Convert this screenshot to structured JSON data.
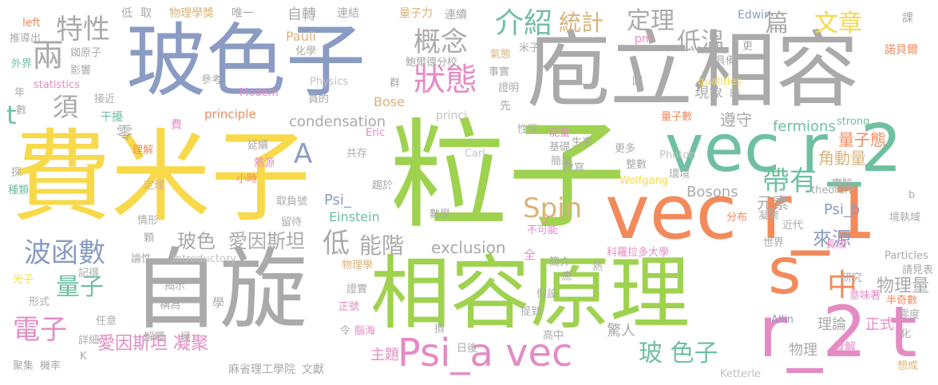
{
  "palette": {
    "yellow": "#f7d94a",
    "green": "#9ed24f",
    "gray": "#aaaaaa",
    "slate": "#8a9cc4",
    "orange": "#f28a5b",
    "pink": "#e48bc4",
    "teal": "#6fc0a0",
    "tan": "#d9b37a",
    "lightgray": "#c2c2c2",
    "darkgray": "#9a9a9a"
  },
  "words": [
    {
      "t": "費米子",
      "c": "yellow"
    },
    {
      "t": "粒子",
      "c": "green"
    },
    {
      "t": "自旋",
      "c": "gray"
    },
    {
      "t": "玻色子",
      "c": "slate"
    },
    {
      "t": "相容原理",
      "c": "green"
    },
    {
      "t": "庖立相容",
      "c": "gray"
    },
    {
      "t": "vec r_1",
      "c": "orange"
    },
    {
      "t": "vec r_2",
      "c": "teal"
    },
    {
      "t": "r_2 t",
      "c": "pink"
    },
    {
      "t": "s",
      "c": "orange"
    },
    {
      "t": "Psi_a vec",
      "c": "pink"
    },
    {
      "t": "兩",
      "c": "gray"
    },
    {
      "t": "特性",
      "c": "gray"
    },
    {
      "t": "概念",
      "c": "gray"
    },
    {
      "t": "狀態",
      "c": "pink"
    },
    {
      "t": "介紹",
      "c": "teal"
    },
    {
      "t": "統計",
      "c": "tan"
    },
    {
      "t": "定理",
      "c": "gray"
    },
    {
      "t": "低溫",
      "c": "gray"
    },
    {
      "t": "篇",
      "c": "gray"
    },
    {
      "t": "文章",
      "c": "yellow"
    },
    {
      "t": "波函數",
      "c": "slate"
    },
    {
      "t": "量子",
      "c": "teal"
    },
    {
      "t": "電子",
      "c": "pink"
    },
    {
      "t": "玻色",
      "c": "gray"
    },
    {
      "t": "愛因斯坦",
      "c": "gray"
    },
    {
      "t": "低",
      "c": "gray"
    },
    {
      "t": "能階",
      "c": "gray"
    },
    {
      "t": "Spin",
      "c": "tan"
    },
    {
      "t": "帶有",
      "c": "teal"
    },
    {
      "t": "中",
      "c": "orange"
    },
    {
      "t": "玻 色子",
      "c": "teal"
    },
    {
      "t": "愛因斯坦 凝聚",
      "c": "pink"
    },
    {
      "t": "A",
      "c": "slate"
    },
    {
      "t": "須",
      "c": "gray"
    },
    {
      "t": "t",
      "c": "teal"
    },
    {
      "t": "condensation",
      "c": "gray"
    },
    {
      "t": "Bose",
      "c": "tan"
    },
    {
      "t": "exclusion",
      "c": "gray"
    },
    {
      "t": "Bosons",
      "c": "gray"
    },
    {
      "t": "Psi_",
      "c": "slate"
    },
    {
      "t": "Einstein",
      "c": "teal"
    },
    {
      "t": "元素",
      "c": "gray"
    },
    {
      "t": "角動量",
      "c": "tan"
    },
    {
      "t": "量子態",
      "c": "orange"
    },
    {
      "t": "fermions",
      "c": "teal"
    },
    {
      "t": "來源",
      "c": "slate"
    },
    {
      "t": "物理量",
      "c": "gray"
    },
    {
      "t": "Psi_b",
      "c": "slate"
    },
    {
      "t": "遵守",
      "c": "gray"
    },
    {
      "t": "現象",
      "c": "gray"
    },
    {
      "t": "驚人",
      "c": "gray"
    },
    {
      "t": "理論",
      "c": "gray"
    },
    {
      "t": "正式",
      "c": "pink"
    },
    {
      "t": "物理",
      "c": "gray"
    },
    {
      "t": "費解",
      "c": "pink"
    },
    {
      "t": "主題",
      "c": "pink"
    },
    {
      "t": "麻省理工學院",
      "c": "gray"
    },
    {
      "t": "文獻",
      "c": "gray"
    },
    {
      "t": "Ketterle",
      "c": "lightgray"
    },
    {
      "t": "Pauli",
      "c": "tan"
    },
    {
      "t": "pm",
      "c": "pink"
    },
    {
      "t": "自轉",
      "c": "gray"
    },
    {
      "t": "量子力",
      "c": "tan"
    },
    {
      "t": "連續",
      "c": "gray"
    },
    {
      "t": "物理學獎",
      "c": "tan"
    },
    {
      "t": "唯一",
      "c": "gray"
    },
    {
      "t": "連結",
      "c": "gray"
    },
    {
      "t": "Edwin",
      "c": "slate"
    },
    {
      "t": "課",
      "c": "gray"
    },
    {
      "t": "諾貝爾",
      "c": "orange"
    },
    {
      "t": "取",
      "c": "gray"
    },
    {
      "t": "低",
      "c": "gray"
    },
    {
      "t": "left",
      "c": "orange"
    },
    {
      "t": "推導出",
      "c": "gray"
    },
    {
      "t": "銣原子",
      "c": "gray"
    },
    {
      "t": "外界",
      "c": "teal"
    },
    {
      "t": "影響",
      "c": "gray"
    },
    {
      "t": "化學",
      "c": "gray"
    },
    {
      "t": "鮑爾德分校",
      "c": "gray"
    },
    {
      "t": "氣態",
      "c": "tan"
    },
    {
      "t": "米子",
      "c": "gray"
    },
    {
      "t": "事實",
      "c": "gray"
    },
    {
      "t": "具備",
      "c": "gray"
    },
    {
      "t": "更",
      "c": "gray"
    },
    {
      "t": "statistics",
      "c": "pink"
    },
    {
      "t": "Physics",
      "c": "lightgray"
    },
    {
      "t": "qualities",
      "c": "yellow"
    },
    {
      "t": "Modern",
      "c": "pink"
    },
    {
      "t": "參考",
      "c": "gray"
    },
    {
      "t": "年",
      "c": "gray"
    },
    {
      "t": "接近",
      "c": "gray"
    },
    {
      "t": "數",
      "c": "gray"
    },
    {
      "t": "員的",
      "c": "gray"
    },
    {
      "t": "群",
      "c": "gray"
    },
    {
      "t": "證明",
      "c": "gray"
    },
    {
      "t": "圖",
      "c": "gray"
    },
    {
      "t": "時",
      "c": "gray"
    },
    {
      "t": "實驗",
      "c": "gray"
    },
    {
      "t": "principle",
      "c": "orange"
    },
    {
      "t": "先",
      "c": "gray"
    },
    {
      "t": "princi",
      "c": "lightgray"
    },
    {
      "t": "干擾",
      "c": "teal"
    },
    {
      "t": "零",
      "c": "gray"
    },
    {
      "t": "費",
      "c": "pink"
    },
    {
      "t": "性質",
      "c": "gray"
    },
    {
      "t": "量子數",
      "c": "orange"
    },
    {
      "t": "strong",
      "c": "teal"
    },
    {
      "t": "理解",
      "c": "orange"
    },
    {
      "t": "Eric",
      "c": "pink"
    },
    {
      "t": "能量",
      "c": "pink"
    },
    {
      "t": "生來",
      "c": "gray"
    },
    {
      "t": "Photon",
      "c": "lightgray"
    },
    {
      "t": "延續",
      "c": "gray"
    },
    {
      "t": "共存",
      "c": "gray"
    },
    {
      "t": "基礎",
      "c": "gray"
    },
    {
      "t": "Carl",
      "c": "lightgray"
    },
    {
      "t": "簡單",
      "c": "gray"
    },
    {
      "t": "更多",
      "c": "gray"
    },
    {
      "t": "整數",
      "c": "gray"
    },
    {
      "t": "熱源",
      "c": "pink"
    },
    {
      "t": "改寫",
      "c": "gray"
    },
    {
      "t": "環境",
      "c": "gray"
    },
    {
      "t": "b",
      "c": "gray"
    },
    {
      "t": "探",
      "c": "gray"
    },
    {
      "t": "小時",
      "c": "orange"
    },
    {
      "t": "趨於",
      "c": "gray"
    },
    {
      "t": "Wolfgang",
      "c": "yellow"
    },
    {
      "t": "theorem",
      "c": "gray"
    },
    {
      "t": "種類",
      "c": "teal"
    },
    {
      "t": "定理",
      "c": "tan"
    },
    {
      "t": "取負號",
      "c": "gray"
    },
    {
      "t": "數學",
      "c": "gray"
    },
    {
      "t": "情形",
      "c": "gray"
    },
    {
      "t": "留待",
      "c": "gray"
    },
    {
      "t": "不可能",
      "c": "pink"
    },
    {
      "t": "分布",
      "c": "orange"
    },
    {
      "t": "凝聚",
      "c": "gray"
    },
    {
      "t": "近代",
      "c": "gray"
    },
    {
      "t": "世界",
      "c": "gray"
    },
    {
      "t": "顆",
      "c": "gray"
    },
    {
      "t": "科羅拉多大學",
      "c": "pink"
    },
    {
      "t": "長成",
      "c": "pink"
    },
    {
      "t": "論性",
      "c": "gray"
    },
    {
      "t": "Introductory",
      "c": "lightgray"
    },
    {
      "t": "Particles",
      "c": "gray"
    },
    {
      "t": "光子",
      "c": "yellow"
    },
    {
      "t": "記得",
      "c": "gray"
    },
    {
      "t": "揭示",
      "c": "gray"
    },
    {
      "t": "全",
      "c": "pink"
    },
    {
      "t": "簡介",
      "c": "gray"
    },
    {
      "t": "應",
      "c": "gray"
    },
    {
      "t": "熱",
      "c": "gray"
    },
    {
      "t": "請見表",
      "c": "gray"
    },
    {
      "t": "物理學",
      "c": "tan"
    },
    {
      "t": "研究",
      "c": "gray"
    },
    {
      "t": "形式",
      "c": "gray"
    },
    {
      "t": "稱為",
      "c": "gray"
    },
    {
      "t": "學",
      "c": "gray"
    },
    {
      "t": "證實",
      "c": "gray"
    },
    {
      "t": "假設",
      "c": "gray"
    },
    {
      "t": "意味著",
      "c": "pink"
    },
    {
      "t": "半奇數",
      "c": "orange"
    },
    {
      "t": "任意",
      "c": "gray"
    },
    {
      "t": "正號",
      "c": "pink"
    },
    {
      "t": "提到",
      "c": "gray"
    },
    {
      "t": "零度",
      "c": "gray"
    },
    {
      "t": "Allin",
      "c": "slate"
    },
    {
      "t": "詳細",
      "c": "gray"
    },
    {
      "t": "解釋",
      "c": "gray"
    },
    {
      "t": "極",
      "c": "gray"
    },
    {
      "t": "令",
      "c": "gray"
    },
    {
      "t": "腦海",
      "c": "pink"
    },
    {
      "t": "擠",
      "c": "gray"
    },
    {
      "t": "高中",
      "c": "gray"
    },
    {
      "t": "化",
      "c": "gray"
    },
    {
      "t": "聚集",
      "c": "gray"
    },
    {
      "t": "機率",
      "c": "gray"
    },
    {
      "t": "日後",
      "c": "gray"
    },
    {
      "t": "想成",
      "c": "tan"
    },
    {
      "t": "K",
      "c": "gray"
    },
    {
      "t": "境執域",
      "c": "gray"
    }
  ]
}
